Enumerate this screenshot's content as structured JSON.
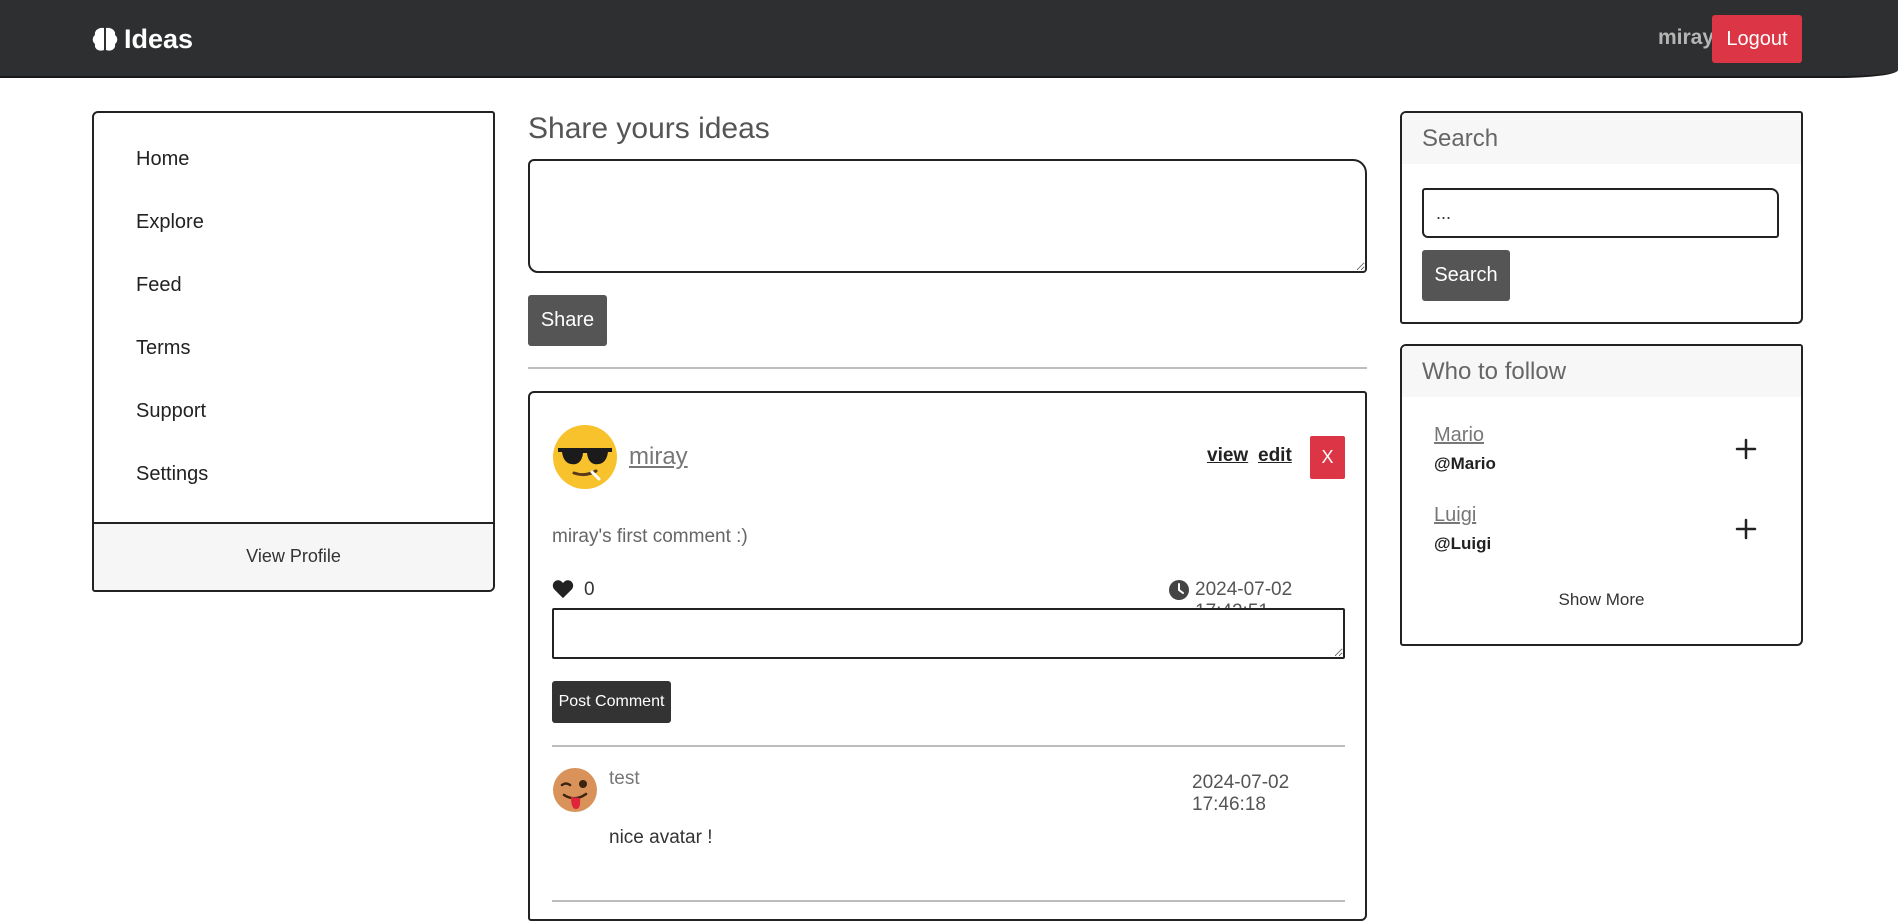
{
  "navbar": {
    "brand": "Ideas",
    "brand_icon": "brain-icon",
    "username": "miray",
    "logout_label": "Logout",
    "logout_color": "#dc3545",
    "background": "#2e2f31"
  },
  "sidebar": {
    "items": [
      {
        "label": "Home"
      },
      {
        "label": "Explore"
      },
      {
        "label": "Feed"
      },
      {
        "label": "Terms"
      },
      {
        "label": "Support"
      },
      {
        "label": "Settings"
      }
    ],
    "footer_label": "View Profile"
  },
  "share": {
    "title": "Share yours ideas",
    "textarea_value": "",
    "button_label": "Share"
  },
  "post": {
    "author": "miray",
    "avatar_icon": "sunglasses-emoji-icon",
    "view_label": "view",
    "edit_label": "edit",
    "delete_label": "X",
    "content": "miray's first comment :)",
    "likes": "0",
    "timestamp": "2024-07-02 17:42:51",
    "comment_input_value": "",
    "comment_button_label": "Post Comment",
    "comments": [
      {
        "author": "test",
        "avatar_icon": "winking-tongue-emoji-icon",
        "timestamp": "2024-07-02 17:46:18",
        "text": "nice avatar !"
      }
    ]
  },
  "search": {
    "title": "Search",
    "input_value": "...",
    "button_label": "Search"
  },
  "follow": {
    "title": "Who to follow",
    "users": [
      {
        "name": "Mario",
        "handle": "@Mario"
      },
      {
        "name": "Luigi",
        "handle": "@Luigi"
      }
    ],
    "show_more_label": "Show More"
  }
}
